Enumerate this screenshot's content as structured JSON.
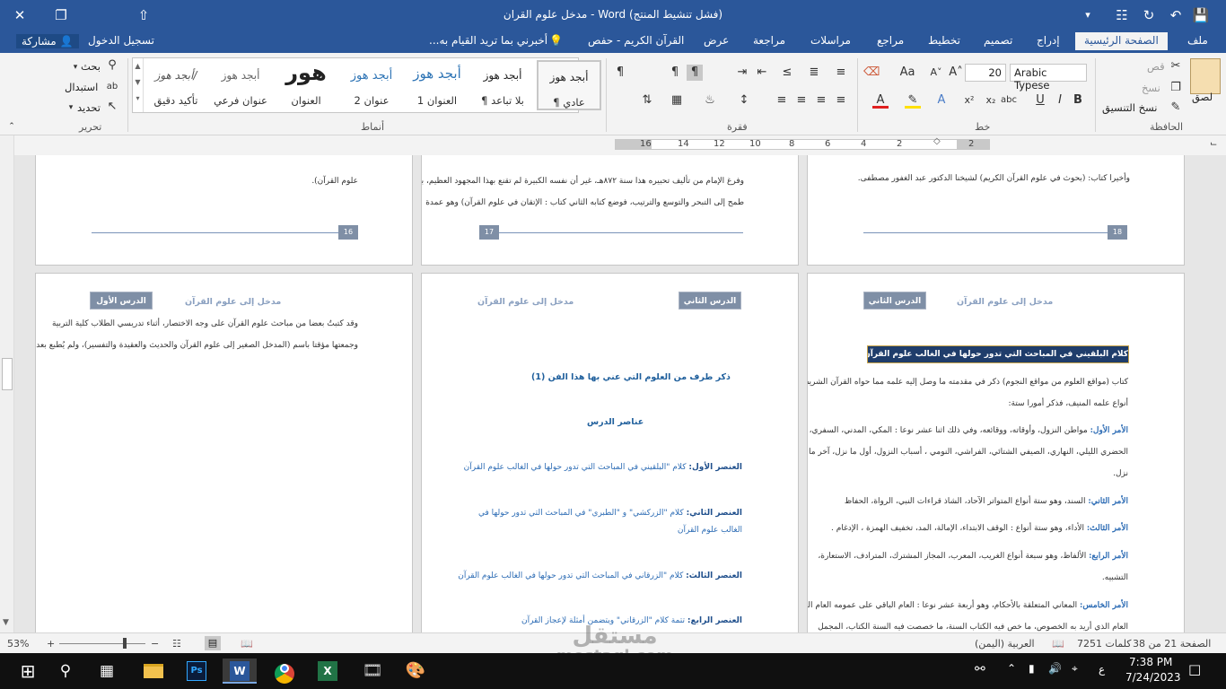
{
  "window": {
    "title": "مدخل علوم القران - Word (فشل تنشيط المنتج)"
  },
  "tabs": [
    "ملف",
    "الصفحة الرئيسية",
    "إدراج",
    "تصميم",
    "تخطيط",
    "مراجع",
    "مراسلات",
    "مراجعة",
    "عرض",
    "القرآن الكريم - حفص"
  ],
  "tellme": "أخبرني بما تريد القيام به...",
  "account": {
    "signin": "تسجيل الدخول",
    "share": "مشاركة"
  },
  "clipboard": {
    "paste": "لصق",
    "cut": "قص",
    "copy": "نسخ",
    "format_painter": "نسخ التنسيق",
    "label": "الحافظة"
  },
  "font": {
    "name": "Arabic Typese",
    "size": "20",
    "label": "خط"
  },
  "paragraph": {
    "label": "فقرة"
  },
  "styles": {
    "label": "أنماط",
    "items": [
      {
        "sample": "أبجد هوز",
        "name": "¶ عادي"
      },
      {
        "sample": "أبجد هوز",
        "name": "¶ بلا تباعد"
      },
      {
        "sample": "أبجد هوز",
        "name": "العنوان 1"
      },
      {
        "sample": "أبجد هوز",
        "name": "عنوان 2"
      },
      {
        "sample": "هور",
        "name": "العنوان"
      },
      {
        "sample": "أبجد هوز",
        "name": "عنوان فرعي"
      },
      {
        "sample": "أبجد هوز/",
        "name": "تأكيد دقيق"
      }
    ]
  },
  "editing": {
    "find": "بحث",
    "replace": "استبدال",
    "select": "تحديد",
    "label": "تحرير"
  },
  "ruler": {
    "ticks": [
      "16",
      "14",
      "12",
      "10",
      "8",
      "6",
      "4",
      "2",
      "2"
    ]
  },
  "pages": {
    "p16": {
      "text1": "علوم القرآن).",
      "num": "16"
    },
    "p17": {
      "text1": "وفرغ الإمام من تأليف تحبيره هذا سنة ٨٧٢هـ، غير أن نفسه الكبيرة لم تقنع بهذا المجهود العظيم، بل",
      "text2": "طمح إلى التبحر والتوسع والترتيب، فوضع كتابه الثاني كتاب : الإتقان في علوم القرآن) وهو عمدة",
      "num": "17"
    },
    "p18": {
      "text1": "وأخيرا كتاب: (بحوث في علوم القرآن الكريم) لشيخنا الدكتور عبد الغفور مصطفى.",
      "num": "18"
    },
    "p19": {
      "header_title": "مدخل إلى علوم القرآن",
      "badge": "الدرس الأول",
      "line1": "وقد كتبتُ بعضا من مباحث علوم القرآن على وجه الاختصار، أثناء تدريسي الطلاب كلية التربية",
      "line2": "وجمعتها مؤقتا باسم (المدخل الصغير إلى علوم القرآن والحديث والعقيدة والتفسير)، ولم يُطبع بعد."
    },
    "p20": {
      "header_title": "مدخل إلى علوم القرآن",
      "badge": "الدرس الثاني",
      "heading1": "ذكر طرف من العلوم التي عني بها هذا الفن (1)",
      "heading2": "عناصر الدرس",
      "el1_lbl": "العنصر الأول:",
      "el1": "كلام \"البلقيني في المباحث التي تدور حولها في الغالب علوم القرآن",
      "el2_lbl": "العنصر الثاني:",
      "el2": "كلام \"الزركشي\" و \"الطبري\" في المباحث التي تدور حولها في",
      "el2b": "الغالب علوم القرآن",
      "el3_lbl": "العنصر الثالث:",
      "el3": "كلام \"الزرقاني في المباحث التي تدور حولها في الغالب علوم القرآن",
      "el4_lbl": "العنصر الرابع:",
      "el4": "تتمة كلام \"الزرقاني\" ويتضمن أمثلة لإعجاز القرآن"
    },
    "p21": {
      "header_title": "مدخل إلى علوم القرآن",
      "badge": "الدرس الثاني",
      "banner": "كلام البلقيني في المباحث التي تدور حولها في الغالب علوم القرآن",
      "intro1": "كتاب (مواقع العلوم من مواقع النجوم) ذكر في مقدمته ما وصل إليه علمه مما حواه القرآن الشريف من",
      "intro2": "أنواع علمه المنيف، فذكر أمورا ستة:",
      "a1_lbl": "الأمر الأول:",
      "a1": "مواطن النزول، وأوقاته، ووقائعه، وفي ذلك اثنا عشر نوعا : المكي، المدني، السفري،",
      "a1b": "الحضري الليلي، النهاري، الصيفي الشتائي، الفراشي، النومي ، أسباب النزول، أول ما نزل، آخر ما",
      "a1c": "نزل.",
      "a2_lbl": "الأمر الثاني:",
      "a2": "السند، وهو ستة أنواع المتواتر الآحاد، الشاذ قراءات النبي، الرواة، الحفاظ",
      "a3_lbl": "الأمر الثالث:",
      "a3": "الأداء، وهو ستة أنواع : الوقف الابتداء، الإمالة، المد، تخفيف الهمزة ، الإدغام .",
      "a4_lbl": "الأمر الرابع:",
      "a4": "الألفاظ، وهو سبعة أنواع الغريب، المعرب، المجاز المشترك، المترادف، الاستعارة،",
      "a4b": "التشبيه.",
      "a5_lbl": "الأمر الخامس:",
      "a5": "المعاني المتعلقة بالأحكام، وهو أربعة عشر نوعا : العام الباقي على عمومه العام المخصوص",
      "a5b": "العام الذي أريد به الخصوص، ما خص فيه الكتاب السنة، ما خصصت فيه السنة الكتاب، المجمل"
    }
  },
  "status": {
    "page": "الصفحة 21 من 38",
    "words": "7251 كلمات",
    "language": "العربية (اليمن)",
    "zoom": "53%"
  },
  "taskbar": {
    "time": "7:38 PM",
    "date": "7/24/2023",
    "lang": "ع"
  },
  "watermark": {
    "line1": "مستقل",
    "line2": "mostaql.com"
  },
  "colors": {
    "word_blue": "#2b579a",
    "accent_blue": "#1f5f9c"
  }
}
